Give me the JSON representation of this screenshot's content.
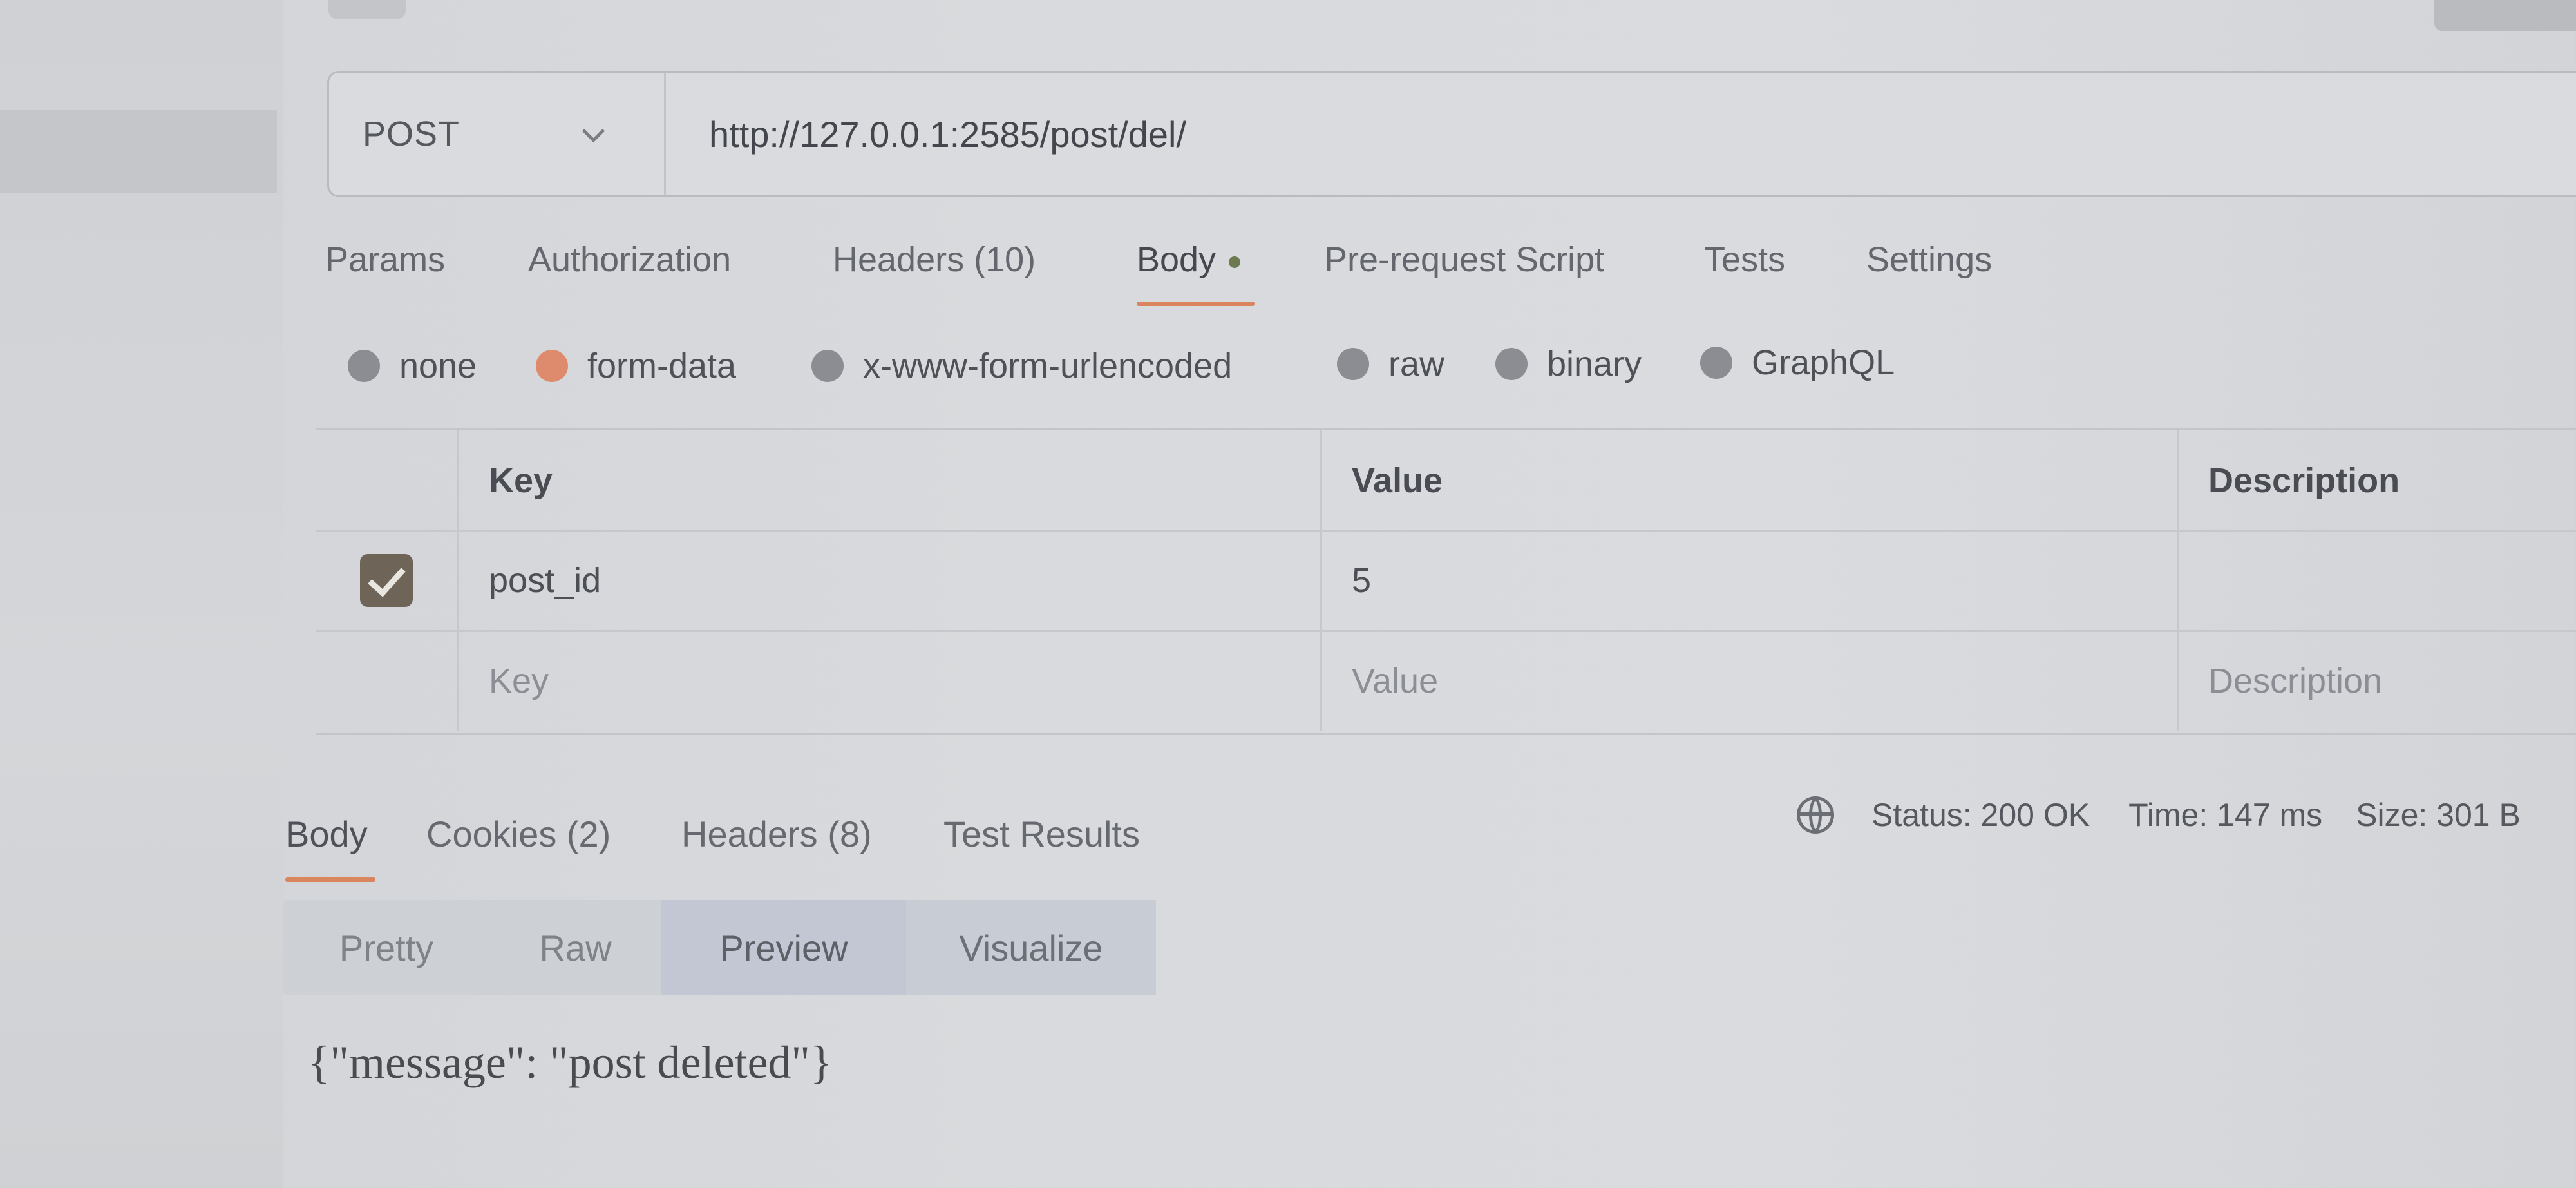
{
  "request": {
    "method": "POST",
    "url": "http://127.0.0.1:2585/post/del/"
  },
  "request_tabs": [
    {
      "label": "Params"
    },
    {
      "label": "Authorization"
    },
    {
      "label": "Headers (10)"
    },
    {
      "label": "Body",
      "active": true
    },
    {
      "label": "Pre-request Script"
    },
    {
      "label": "Tests"
    },
    {
      "label": "Settings"
    }
  ],
  "body_types": [
    {
      "label": "none",
      "selected": false
    },
    {
      "label": "form-data",
      "selected": true
    },
    {
      "label": "x-www-form-urlencoded",
      "selected": false
    },
    {
      "label": "raw",
      "selected": false
    },
    {
      "label": "binary",
      "selected": false
    },
    {
      "label": "GraphQL",
      "selected": false
    }
  ],
  "form_table": {
    "headers": {
      "key": "Key",
      "value": "Value",
      "description": "Description"
    },
    "rows": [
      {
        "checked": true,
        "key": "post_id",
        "value": "5",
        "description": ""
      }
    ],
    "placeholders": {
      "key": "Key",
      "value": "Value",
      "description": "Description"
    }
  },
  "response_tabs": [
    {
      "label": "Body",
      "active": true
    },
    {
      "label": "Cookies (2)"
    },
    {
      "label": "Headers (8)"
    },
    {
      "label": "Test Results"
    }
  ],
  "response_meta": {
    "status": "Status: 200 OK",
    "time": "Time: 147 ms",
    "size": "Size: 301 B"
  },
  "view_modes": [
    {
      "label": "Pretty"
    },
    {
      "label": "Raw"
    },
    {
      "label": "Preview",
      "selected": true
    },
    {
      "label": "Visualize"
    }
  ],
  "response_body": "{\"message\": \"post deleted\"}",
  "colors": {
    "accent": "#d9865f",
    "body_dot": "#6c7b4f",
    "checkbox": "#6e6458",
    "radio_selected": "#dd8b6c"
  }
}
